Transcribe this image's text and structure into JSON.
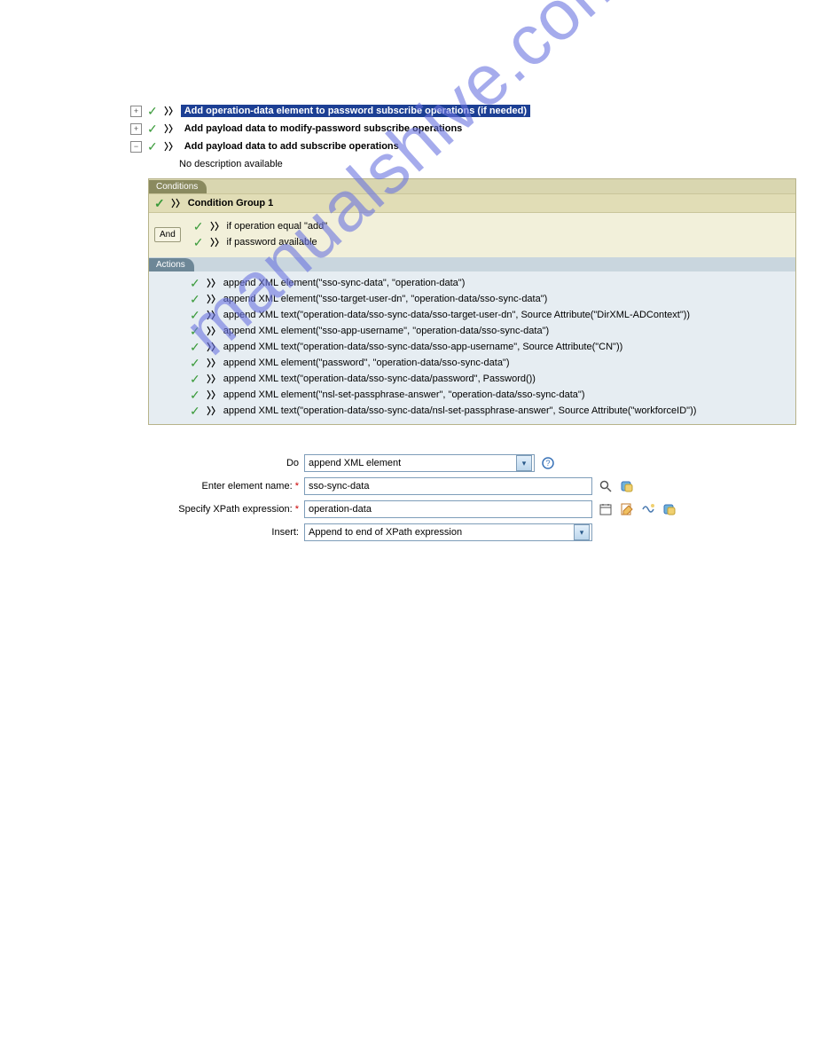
{
  "rules": [
    {
      "expand": "plus",
      "title": "Add operation-data element to password subscribe operations (if needed)",
      "selected": true
    },
    {
      "expand": "plus",
      "title": "Add payload data to modify-password subscribe operations",
      "selected": false
    },
    {
      "expand": "minus",
      "title": "Add payload data to add subscribe operations",
      "selected": false
    }
  ],
  "description": "No description available",
  "conditions": {
    "tab": "Conditions",
    "group_label": "Condition Group 1",
    "and_label": "And",
    "items": [
      "if operation equal \"add\"",
      "if password available"
    ]
  },
  "actions": {
    "tab": "Actions",
    "items": [
      "append XML element(\"sso-sync-data\", \"operation-data\")",
      "append XML element(\"sso-target-user-dn\", \"operation-data/sso-sync-data\")",
      "append XML text(\"operation-data/sso-sync-data/sso-target-user-dn\", Source Attribute(\"DirXML-ADContext\"))",
      "append XML element(\"sso-app-username\", \"operation-data/sso-sync-data\")",
      "append XML text(\"operation-data/sso-sync-data/sso-app-username\", Source Attribute(\"CN\"))",
      "append XML element(\"password\", \"operation-data/sso-sync-data\")",
      "append XML text(\"operation-data/sso-sync-data/password\", Password())",
      "append XML element(\"nsl-set-passphrase-answer\", \"operation-data/sso-sync-data\")",
      "append XML text(\"operation-data/sso-sync-data/nsl-set-passphrase-answer\", Source Attribute(\"workforceID\"))"
    ]
  },
  "form": {
    "do_label": "Do",
    "do_value": "append XML element",
    "element_name_label": "Enter element name:",
    "element_name_value": "sso-sync-data",
    "xpath_label": "Specify XPath expression:",
    "xpath_value": "operation-data",
    "insert_label": "Insert:",
    "insert_value": "Append to end of XPath expression"
  },
  "watermark": "manualshive.com"
}
